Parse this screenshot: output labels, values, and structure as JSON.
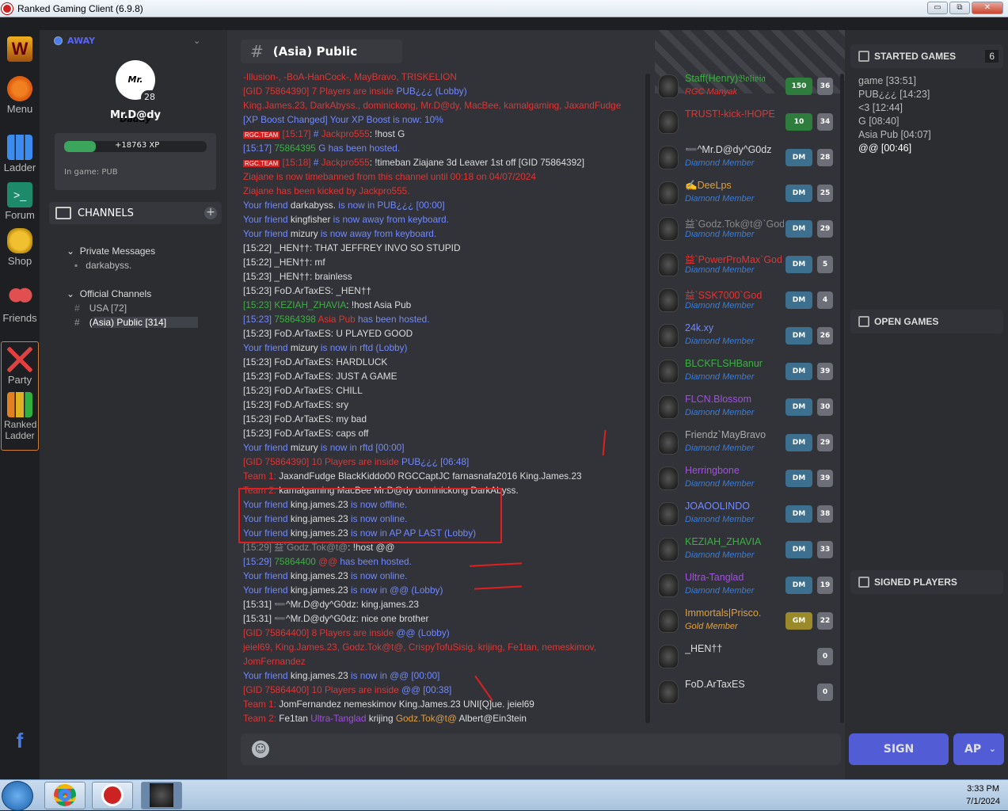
{
  "window": {
    "title": "Ranked Gaming Client (6.9.8)",
    "minimize": "▭",
    "maximize": "⧉",
    "close": "✕"
  },
  "nav": [
    {
      "name": "wc3-icon",
      "label": ""
    },
    {
      "name": "menu",
      "label": "Menu"
    },
    {
      "name": "ladder",
      "label": "Ladder"
    },
    {
      "name": "forum",
      "label": "Forum"
    },
    {
      "name": "shop",
      "label": "Shop"
    },
    {
      "name": "friends",
      "label": "Friends"
    },
    {
      "name": "party",
      "label": "Party"
    },
    {
      "name": "ranked-ladder",
      "label": "Ranked Ladder"
    },
    {
      "name": "facebook",
      "label": "f"
    }
  ],
  "profile": {
    "status": "AWAY",
    "avatar_text": "Mr. Daddy",
    "level": "28",
    "name": "Mr.D@dy",
    "xp": "+18763 XP",
    "xp_fraction": 0.22,
    "in_game": "In game: PUB"
  },
  "channels": {
    "header": "CHANNELS",
    "private_group": "Private Messages",
    "private_items": [
      "darkabyss."
    ],
    "official_group": "Official Channels",
    "official_items": [
      "USA [72]",
      "(Asia) Public [314]"
    ]
  },
  "chat": {
    "channel_hash": "#",
    "channel_name": "(Asia) Public",
    "messages": [
      [
        {
          "c": "red",
          "t": "-Illusion-, -BoA-HanCock-, MayBravo, TRISKELION"
        }
      ],
      [
        {
          "c": "red",
          "t": "[GID 75864390] 7 "
        },
        {
          "c": "red",
          "t": "Players are inside "
        },
        {
          "c": "blue",
          "t": "PUB¿¿¿ (Lobby)"
        }
      ],
      [
        {
          "c": "red",
          "t": "King.James.23, DarkAbyss., dominickong, Mr.D@dy, MacBee, kamalgaming, JaxandFudge"
        }
      ],
      [
        {
          "c": "blue",
          "t": "[XP Boost Changed] Your XP Boost is now: 10%"
        }
      ],
      [
        {
          "c": "tag",
          "t": "RGC.TEAM"
        },
        {
          "c": "red",
          "t": " [15:17] "
        },
        {
          "c": "blue",
          "t": "# "
        },
        {
          "c": "red",
          "t": "Jackpro555"
        },
        {
          "c": "wht",
          "t": ": !host G"
        }
      ],
      [
        {
          "c": "blue",
          "t": "[15:17] "
        },
        {
          "c": "grn",
          "t": "75864395 "
        },
        {
          "c": "blue",
          "t": "G has been hosted."
        }
      ],
      [
        {
          "c": "tag",
          "t": "RGC.TEAM"
        },
        {
          "c": "red",
          "t": " [15:18] "
        },
        {
          "c": "blue",
          "t": "# "
        },
        {
          "c": "red",
          "t": "Jackpro555"
        },
        {
          "c": "wht",
          "t": ": !timeban Ziajane 3d Leaver 1st off [GID 75864392]"
        }
      ],
      [
        {
          "c": "red",
          "t": "Ziajane is now timebanned from this channel until 00:18 on 04/07/2024"
        }
      ],
      [
        {
          "c": "red",
          "t": "Ziajane has been kicked by Jackpro555."
        }
      ],
      [
        {
          "c": "blue",
          "t": "Your friend "
        },
        {
          "c": "wht",
          "t": "darkabyss."
        },
        {
          "c": "blue",
          "t": " is now in PUB¿¿¿ [00:00]"
        }
      ],
      [
        {
          "c": "blue",
          "t": "Your friend "
        },
        {
          "c": "wht",
          "t": "kingfisher"
        },
        {
          "c": "blue",
          "t": " is now away from keyboard."
        }
      ],
      [
        {
          "c": "blue",
          "t": "Your friend "
        },
        {
          "c": "wht",
          "t": "mizury"
        },
        {
          "c": "blue",
          "t": " is now away from keyboard."
        }
      ],
      [
        {
          "c": "wht",
          "t": "[15:22] _HEN††: THAT JEFFREY INVO SO STUPID"
        }
      ],
      [
        {
          "c": "wht",
          "t": "[15:22] _HEN††: mf"
        }
      ],
      [
        {
          "c": "wht",
          "t": "[15:23] _HEN††: brainless"
        }
      ],
      [
        {
          "c": "wht",
          "t": "[15:23] FoD.ArTaxES: _HEN††"
        }
      ],
      [
        {
          "c": "grn",
          "t": "[15:23] KEZIAH_ZHAVIA"
        },
        {
          "c": "wht",
          "t": ": !host Asia Pub"
        }
      ],
      [
        {
          "c": "blue",
          "t": "[15:23] "
        },
        {
          "c": "grn",
          "t": "75864398 "
        },
        {
          "c": "red",
          "t": "Asia Pub"
        },
        {
          "c": "blue",
          "t": " has been hosted."
        }
      ],
      [
        {
          "c": "wht",
          "t": "[15:23] FoD.ArTaxES: U PLAYED GOOD"
        }
      ],
      [
        {
          "c": "blue",
          "t": "Your friend "
        },
        {
          "c": "wht",
          "t": "mizury"
        },
        {
          "c": "blue",
          "t": " is now in rftd (Lobby)"
        }
      ],
      [
        {
          "c": "wht",
          "t": "[15:23] FoD.ArTaxES: HARDLUCK"
        }
      ],
      [
        {
          "c": "wht",
          "t": "[15:23] FoD.ArTaxES: JUST A GAME"
        }
      ],
      [
        {
          "c": "wht",
          "t": "[15:23] FoD.ArTaxES: CHILL"
        }
      ],
      [
        {
          "c": "wht",
          "t": "[15:23] FoD.ArTaxES: sry"
        }
      ],
      [
        {
          "c": "wht",
          "t": "[15:23] FoD.ArTaxES: my bad"
        }
      ],
      [
        {
          "c": "wht",
          "t": "[15:23] FoD.ArTaxES: caps off"
        }
      ],
      [
        {
          "c": "blue",
          "t": "Your friend "
        },
        {
          "c": "wht",
          "t": "mizury"
        },
        {
          "c": "blue",
          "t": " is now in rftd [00:00]"
        }
      ],
      [
        {
          "c": "red",
          "t": "[GID 75864390] 10 "
        },
        {
          "c": "red",
          "t": "Players are inside "
        },
        {
          "c": "blue",
          "t": "PUB¿¿¿ [06:48]"
        }
      ],
      [
        {
          "c": "red",
          "t": "Team 1: "
        },
        {
          "c": "wht",
          "t": "  JaxandFudge   BlackKiddo00   RGCCaptJC   farnasnafa2016   King.James.23"
        }
      ],
      [
        {
          "c": "red",
          "t": "Team 2: "
        },
        {
          "c": "wht",
          "t": "  kamalgaming   MacBee   Mr.D@dy   dominickong   DarkAbyss."
        }
      ],
      [
        {
          "c": "blue",
          "t": "Your friend "
        },
        {
          "c": "wht",
          "t": "king.james.23"
        },
        {
          "c": "blue",
          "t": " is now offline."
        }
      ],
      [
        {
          "c": "blue",
          "t": "Your friend "
        },
        {
          "c": "wht",
          "t": "king.james.23"
        },
        {
          "c": "blue",
          "t": " is now online."
        }
      ],
      [
        {
          "c": "blue",
          "t": "Your friend "
        },
        {
          "c": "wht",
          "t": "king.james.23"
        },
        {
          "c": "blue",
          "t": " is now in AP AP LAST (Lobby)"
        }
      ],
      [
        {
          "c": "dark",
          "t": "[15:29] 益`Godz.Tok@t@"
        },
        {
          "c": "wht",
          "t": ": !host @@"
        }
      ],
      [
        {
          "c": "blue",
          "t": "[15:29] "
        },
        {
          "c": "grn",
          "t": "75864400 "
        },
        {
          "c": "red",
          "t": "@@"
        },
        {
          "c": "blue",
          "t": " has been hosted."
        }
      ],
      [
        {
          "c": "blue",
          "t": "Your friend "
        },
        {
          "c": "wht",
          "t": "king.james.23"
        },
        {
          "c": "blue",
          "t": " is now online."
        }
      ],
      [
        {
          "c": "blue",
          "t": "Your friend "
        },
        {
          "c": "wht",
          "t": "king.james.23"
        },
        {
          "c": "blue",
          "t": " is now in @@ (Lobby)"
        }
      ],
      [
        {
          "c": "wht",
          "t": "[15:31] ➖^Mr.D@dy^G0dz: king.james.23"
        }
      ],
      [
        {
          "c": "wht",
          "t": "[15:31] ➖^Mr.D@dy^G0dz: nice one brother"
        }
      ],
      [
        {
          "c": "red",
          "t": "[GID 75864400] 8 "
        },
        {
          "c": "red",
          "t": "Players are inside "
        },
        {
          "c": "blue",
          "t": "@@ (Lobby)"
        }
      ],
      [
        {
          "c": "red",
          "t": "jeiel69, King.James.23, Godz.Tok@t@, CrispyTofuSisig, krijing, Fe1tan, nemeskimov,"
        }
      ],
      [
        {
          "c": "red",
          "t": "JomFernandez"
        }
      ],
      [
        {
          "c": "blue",
          "t": "Your friend "
        },
        {
          "c": "wht",
          "t": "king.james.23"
        },
        {
          "c": "blue",
          "t": " is now in @@ [00:00]"
        }
      ],
      [
        {
          "c": "red",
          "t": "[GID 75864400] 10 "
        },
        {
          "c": "red",
          "t": "Players are inside "
        },
        {
          "c": "blue",
          "t": "@@ [00:38]"
        }
      ],
      [
        {
          "c": "red",
          "t": "Team 1: "
        },
        {
          "c": "wht",
          "t": "  JomFernandez   nemeskimov   King.James.23   UNI[Q]ue.   jeiel69"
        }
      ],
      [
        {
          "c": "red",
          "t": "Team 2: "
        },
        {
          "c": "wht",
          "t": "  Fe1tan   "
        },
        {
          "c": "purple",
          "t": "Ultra-Tanglad"
        },
        {
          "c": "wht",
          "t": "   krijing   "
        },
        {
          "c": "gold",
          "t": "Godz.Tok@t@"
        },
        {
          "c": "wht",
          "t": "   Albert@Ein3tein"
        }
      ]
    ]
  },
  "members": [
    {
      "name": "Staff(Henry)𝔅𝔬𝔩𝔦𝔳𝔦𝔞",
      "color": "#3cb043",
      "role": "RGC Manyak",
      "role_color": "#e03535",
      "btn": "150",
      "btn_class": "g",
      "count": "36"
    },
    {
      "name": "TRUST!-kick-!HOPE",
      "color": "#e03535",
      "role": "",
      "role_color": "#3b7cd6",
      "btn": "10",
      "btn_class": "g",
      "count": "34"
    },
    {
      "name": "➖^Mr.D@dy^G0dz",
      "color": "#ddd",
      "role": "Diamond Member",
      "role_color": "#3b7cd6",
      "btn": "DM",
      "btn_class": "",
      "count": "28"
    },
    {
      "name": "✍DeeLps",
      "color": "#e0a040",
      "role": "Diamond Member",
      "role_color": "#3b7cd6",
      "btn": "DM",
      "btn_class": "",
      "count": "25"
    },
    {
      "name": "益`Godz.Tok@t@`God",
      "color": "#888",
      "role": "Diamond Member",
      "role_color": "#3b7cd6",
      "btn": "DM",
      "btn_class": "",
      "count": "29"
    },
    {
      "name": "益`PowerProMax`God",
      "color": "#e03535",
      "role": "Diamond Member",
      "role_color": "#3b7cd6",
      "btn": "DM",
      "btn_class": "",
      "count": "5"
    },
    {
      "name": "益`SSK7000`God",
      "color": "#e03535",
      "role": "Diamond Member",
      "role_color": "#3b7cd6",
      "btn": "DM",
      "btn_class": "",
      "count": "4"
    },
    {
      "name": "24k.xy",
      "color": "#7289ff",
      "role": "Diamond Member",
      "role_color": "#3b7cd6",
      "btn": "DM",
      "btn_class": "",
      "count": "26"
    },
    {
      "name": "BLCKFLSHBanur",
      "color": "#3cb043",
      "role": "Diamond Member",
      "role_color": "#3b7cd6",
      "btn": "DM",
      "btn_class": "",
      "count": "39"
    },
    {
      "name": "FLCN.Blossom",
      "color": "#a050e0",
      "role": "Diamond Member",
      "role_color": "#3b7cd6",
      "btn": "DM",
      "btn_class": "",
      "count": "30"
    },
    {
      "name": "Friendz`MayBravo",
      "color": "#aaa",
      "role": "Diamond Member",
      "role_color": "#3b7cd6",
      "btn": "DM",
      "btn_class": "",
      "count": "29"
    },
    {
      "name": "Herringbone",
      "color": "#a050e0",
      "role": "Diamond Member",
      "role_color": "#3b7cd6",
      "btn": "DM",
      "btn_class": "",
      "count": "39"
    },
    {
      "name": "JOAOOLINDO",
      "color": "#7289ff",
      "role": "Diamond Member",
      "role_color": "#3b7cd6",
      "btn": "DM",
      "btn_class": "",
      "count": "38"
    },
    {
      "name": "KEZIAH_ZHAVIA",
      "color": "#3cb043",
      "role": "Diamond Member",
      "role_color": "#3b7cd6",
      "btn": "DM",
      "btn_class": "",
      "count": "33"
    },
    {
      "name": "Ultra-Tanglad",
      "color": "#a050e0",
      "role": "Diamond Member",
      "role_color": "#3b7cd6",
      "btn": "DM",
      "btn_class": "",
      "count": "19"
    },
    {
      "name": "Immortals|Prisco.",
      "color": "#e0a040",
      "role": "Gold Member",
      "role_color": "#e0a040",
      "btn": "GM",
      "btn_class": "gm",
      "count": "22"
    },
    {
      "name": "_HEN††",
      "color": "#ddd",
      "role": "",
      "role_color": "#3b7cd6",
      "btn": "",
      "btn_class": "",
      "count": "0"
    },
    {
      "name": "FoD.ArTaxES",
      "color": "#ddd",
      "role": "",
      "role_color": "#3b7cd6",
      "btn": "",
      "btn_class": "",
      "count": "0"
    }
  ],
  "right": {
    "started_title": "STARTED GAMES",
    "started_count": "6",
    "games": [
      "game [33:51]",
      "PUB¿¿¿ [14:23]",
      "<3 [12:44]",
      "G [08:40]",
      "Asia Pub [04:07]",
      "@@ [00:46]"
    ],
    "open_title": "OPEN GAMES",
    "signed_title": "SIGNED PLAYERS"
  },
  "actions": {
    "sign": "SIGN",
    "ap": "AP"
  },
  "taskbar": {
    "time": "3:33 PM",
    "date": "7/1/2024"
  }
}
